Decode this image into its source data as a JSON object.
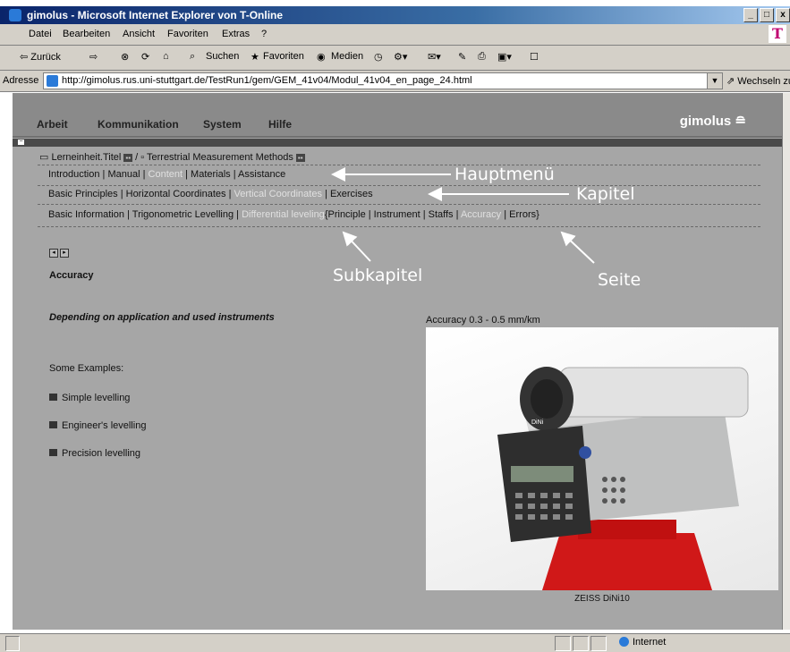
{
  "window": {
    "title": "gimolus - Microsoft Internet Explorer von T-Online",
    "controls": [
      "_",
      "□",
      "x"
    ]
  },
  "menubar": [
    "Datei",
    "Bearbeiten",
    "Ansicht",
    "Favoriten",
    "Extras",
    "?"
  ],
  "brand_logo": "T",
  "toolbar": {
    "back": "⇦ Zurück",
    "forward": "⇨",
    "search": "Suchen",
    "favorites": "Favoriten",
    "media": "Medien"
  },
  "address": {
    "label": "Adresse",
    "url": "http://gimolus.rus.uni-stuttgart.de/TestRun1/gem/GEM_41v04/Modul_41v04_en_page_24.html",
    "go": "Wechseln zu"
  },
  "app": {
    "menu": [
      "Arbeit",
      "Kommunikation",
      "System",
      "Hilfe"
    ],
    "logo": "gimolus"
  },
  "breadcrumb": {
    "item1": "Lerneinheit.Titel",
    "separator": "/",
    "item2": "Terrestrial Measurement Methods"
  },
  "nav": {
    "main": [
      {
        "label": "Introduction",
        "active": false
      },
      {
        "label": "Manual",
        "active": false
      },
      {
        "label": "Content",
        "active": true
      },
      {
        "label": "Materials",
        "active": false
      },
      {
        "label": "Assistance",
        "active": false
      }
    ],
    "chapter": [
      {
        "label": "Basic Principles",
        "active": false
      },
      {
        "label": "Horizontal Coordinates",
        "active": false
      },
      {
        "label": "Vertical Coordinates",
        "active": true
      },
      {
        "label": "Exercises",
        "active": false
      }
    ],
    "sub": {
      "items": [
        "Basic Information",
        "Trigonometric Levelling"
      ],
      "active": "Differential leveling",
      "pages": [
        {
          "label": "Principle",
          "active": false
        },
        {
          "label": "Instrument",
          "active": false
        },
        {
          "label": "Staffs",
          "active": false
        },
        {
          "label": "Accuracy",
          "active": true
        },
        {
          "label": "Errors",
          "active": false
        }
      ]
    }
  },
  "annotations": {
    "main_menu": "Hauptmenü",
    "chapter": "Kapitel",
    "subchapter": "Subkapitel",
    "page": "Seite"
  },
  "content": {
    "heading": "Accuracy",
    "subtitle": "Depending on application and used instruments",
    "examples_label": "Some Examples:",
    "examples": [
      "Simple levelling",
      "Engineer's levelling",
      "Precision levelling"
    ],
    "image_caption_top": "Accuracy 0.3 - 0.5 mm/km",
    "image_caption_bottom": "ZEISS DiNi10",
    "image_label": "DiNi"
  },
  "status": {
    "zone": "Internet"
  },
  "colors": {
    "page_bg": "#a6a6a6",
    "appbar_bg": "#8a8a8a",
    "highlight_text": "#e0e0e0",
    "annotation": "#ffffff",
    "tripod_red": "#d01818"
  }
}
